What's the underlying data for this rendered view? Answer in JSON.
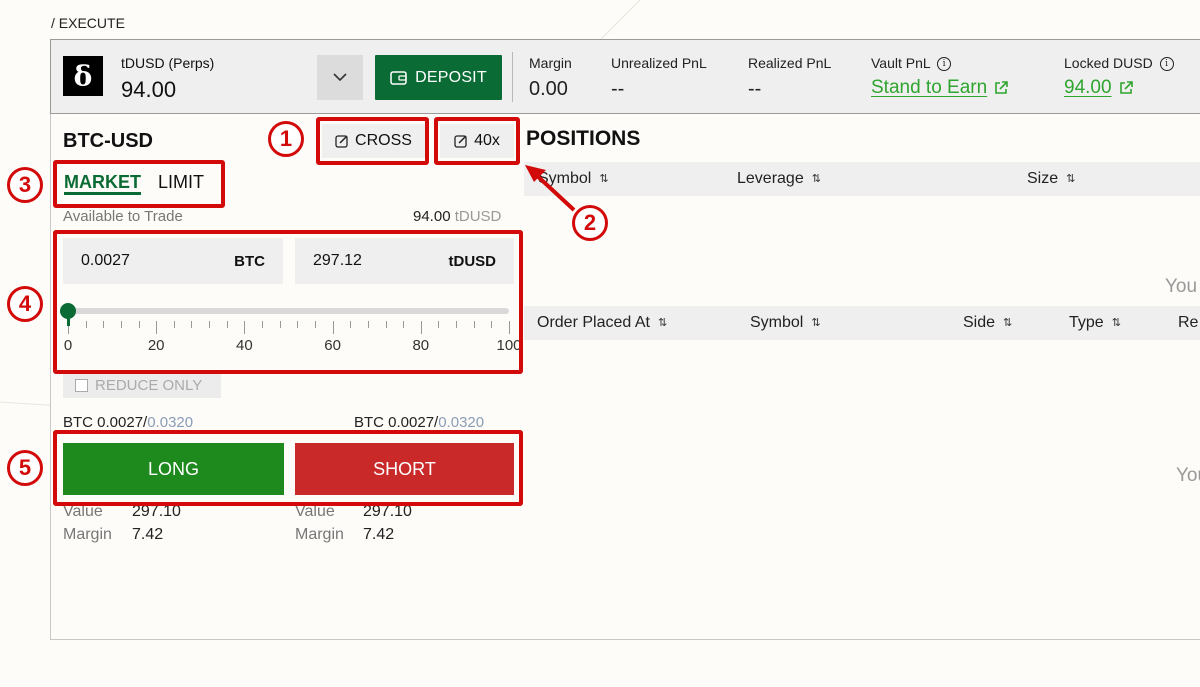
{
  "breadcrumb": "/ EXECUTE",
  "account": {
    "logo_glyph": "δ",
    "name": "tDUSD (Perps)",
    "balance": "94.00",
    "deposit_label": "DEPOSIT",
    "stats": {
      "margin": {
        "label": "Margin",
        "value": "0.00"
      },
      "unrealized": {
        "label": "Unrealized PnL",
        "value": "--"
      },
      "realized": {
        "label": "Realized PnL",
        "value": "--"
      },
      "vault": {
        "label": "Vault PnL",
        "value": "Stand to Earn"
      },
      "locked": {
        "label": "Locked DUSD",
        "value": "94.00"
      }
    }
  },
  "trade": {
    "pair": "BTC-USD",
    "margin_mode": "CROSS",
    "leverage": "40x",
    "tabs": {
      "market": "MARKET",
      "limit": "LIMIT"
    },
    "available_label": "Available to Trade",
    "available_value": "94.00",
    "available_unit": "tDUSD",
    "size_btc": "0.0027",
    "size_btc_unit": "BTC",
    "size_usd": "297.12",
    "size_usd_unit": "tDUSD",
    "slider_percent": 0,
    "slider_labels": [
      "0",
      "20",
      "40",
      "60",
      "80",
      "100"
    ],
    "reduce_only_label": "REDUCE ONLY",
    "qty_long": {
      "prefix": "BTC 0.0027/",
      "max": "0.0320"
    },
    "qty_short": {
      "prefix": "BTC 0.0027/",
      "max": "0.0320"
    },
    "long_label": "LONG",
    "short_label": "SHORT",
    "long_summary": {
      "value_label": "Value",
      "value": "297.10",
      "margin_label": "Margin",
      "margin": "7.42"
    },
    "short_summary": {
      "value_label": "Value",
      "value": "297.10",
      "margin_label": "Margin",
      "margin": "7.42"
    }
  },
  "positions": {
    "title": "POSITIONS",
    "columns": [
      "Symbol",
      "Leverage",
      "Size"
    ],
    "empty_text": "You"
  },
  "orders": {
    "columns": [
      "Order Placed At",
      "Symbol",
      "Side",
      "Type",
      "Re"
    ],
    "empty_text": "You"
  },
  "annotations": [
    "1",
    "2",
    "3",
    "4",
    "5"
  ],
  "colors": {
    "accent_green": "#0b6b34",
    "long": "#1e8a1e",
    "short": "#c92929",
    "link": "#2fa52f",
    "annotation": "#d20a0a"
  }
}
